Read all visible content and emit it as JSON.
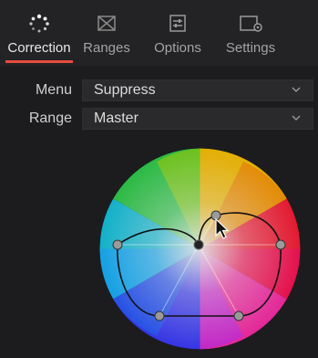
{
  "tabs": [
    {
      "label": "Correction",
      "icon": "loading-dots-icon",
      "active": true
    },
    {
      "label": "Ranges",
      "icon": "ranges-icon",
      "active": false
    },
    {
      "label": "Options",
      "icon": "options-sliders-icon",
      "active": false
    },
    {
      "label": "Settings",
      "icon": "settings-icon",
      "active": false
    }
  ],
  "form": {
    "menu_label": "Menu",
    "menu_value": "Suppress",
    "range_label": "Range",
    "range_value": "Master"
  },
  "colors": {
    "accent": "#e64a3c",
    "panel_bg": "#1c1c1e"
  }
}
